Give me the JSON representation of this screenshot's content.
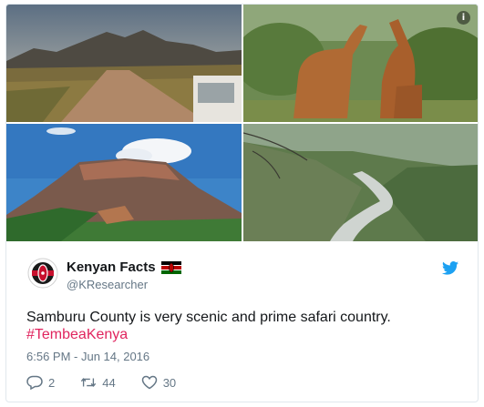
{
  "tweet": {
    "author_name": "Kenyan Facts",
    "author_handle": "@KResearcher",
    "text": "Samburu County is very scenic and prime safari country.",
    "hashtag": "#TembeaKenya",
    "timestamp": "6:56 PM - Jun 14, 2016",
    "replies": "2",
    "retweets": "44",
    "likes": "30"
  },
  "icons": {
    "info": "i",
    "brand": "twitter-bird-icon",
    "reply": "speech-bubble-icon",
    "retweet": "retweet-arrows-icon",
    "like": "heart-icon"
  },
  "colors": {
    "text": "#14171a",
    "muted": "#657786",
    "hashtag": "#e0245e",
    "twitter_blue": "#1da1f2",
    "border": "#e1e8ed"
  }
}
